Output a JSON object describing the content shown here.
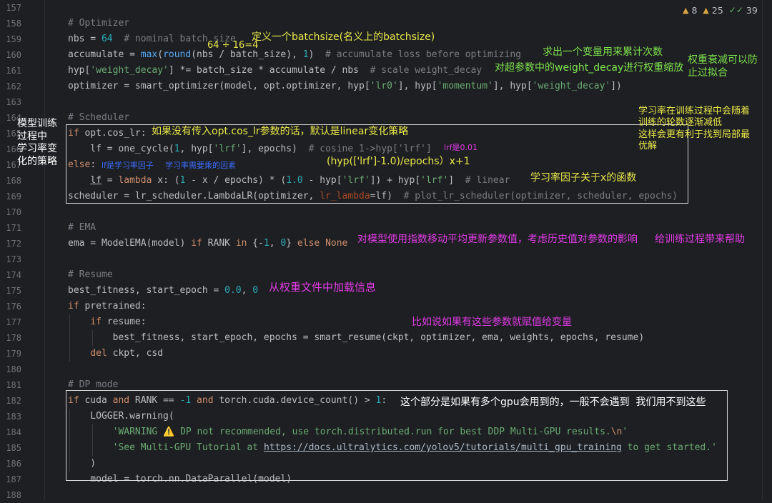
{
  "gutter": {
    "line_numbers": [
      "157",
      "158",
      "159",
      "160",
      "161",
      "162",
      "163",
      "164",
      "165",
      "166",
      "167",
      "168",
      "169",
      "170",
      "171",
      "172",
      "173",
      "174",
      "175",
      "176",
      "177",
      "178",
      "179",
      "180",
      "181",
      "182",
      "183",
      "184",
      "185",
      "186",
      "187",
      "188"
    ]
  },
  "inspection": {
    "warnings_a": "8",
    "warnings_b": "25",
    "ok": "39",
    "icon_warning": "warning-triangle",
    "icon_check": "double-check"
  },
  "code": {
    "l158_cm": "# Optimizer",
    "l159_a": "nbs = ",
    "l159_n": "64",
    "l159_cm": "  # nominal batch size",
    "l160_a": "accumulate = ",
    "l160_f1": "max",
    "l160_b": "(",
    "l160_f2": "round",
    "l160_c": "(nbs / batch_size), ",
    "l160_n": "1",
    "l160_d": ")",
    "l160_cm": "  # accumulate loss before optimizing",
    "l161_a": "hyp[",
    "l161_s": "'weight_decay'",
    "l161_b": "] *= batch_size * accumulate / nbs",
    "l161_cm": "  # scale weight_decay",
    "l162_a": "optimizer = smart_optimizer(model, opt.optimizer, hyp[",
    "l162_s1": "'lr0'",
    "l162_b": "], hyp[",
    "l162_s2": "'momentum'",
    "l162_c": "], hyp[",
    "l162_s3": "'weight_decay'",
    "l162_d": "])",
    "l164_cm": "# Scheduler",
    "l165_k": "if",
    "l165_a": " opt.cos_lr:",
    "l166_a": "    lf = one_cycle(",
    "l166_n": "1",
    "l166_b": ", hyp[",
    "l166_s": "'lrf'",
    "l166_c": "], epochs)",
    "l166_cm": "  # cosine 1->hyp['lrf']",
    "l167_k": "else",
    "l167_a": ":",
    "l168_i": "    ",
    "l168_a": "lf",
    "l168_b": " = ",
    "l168_k": "lambda",
    "l168_c": " x: (",
    "l168_n1": "1",
    "l168_d": " - x / epochs) * (",
    "l168_n2": "1.0",
    "l168_e": " - hyp[",
    "l168_s1": "'lrf'",
    "l168_f": "]) + hyp[",
    "l168_s2": "'lrf'",
    "l168_g": "]",
    "l168_cm": "  # linear",
    "l169_a": "scheduler = lr_scheduler.LambdaLR(optimizer, ",
    "l169_p": "lr_lambda",
    "l169_b": "=lf)",
    "l169_cm": "  # plot_lr_scheduler(optimizer, scheduler, epochs)",
    "l171_cm": "# EMA",
    "l172_a": "ema = ModelEMA(model) ",
    "l172_k1": "if",
    "l172_b": " RANK ",
    "l172_k2": "in",
    "l172_c": " {-",
    "l172_n1": "1",
    "l172_d": ", ",
    "l172_n2": "0",
    "l172_e": "} ",
    "l172_k3": "else",
    "l172_f": " ",
    "l172_k4": "None",
    "l174_cm": "# Resume",
    "l175_a": "best_fitness, start_epoch = ",
    "l175_n1": "0.0",
    "l175_b": ", ",
    "l175_n2": "0",
    "l176_k": "if",
    "l176_a": " pretrained:",
    "l177_i": "    ",
    "l177_k": "if",
    "l177_a": " resume:",
    "l178_a": "        best_fitness, start_epoch, epochs = smart_resume(ckpt, optimizer, ema, weights, epochs, resume)",
    "l179_i": "    ",
    "l179_k": "del",
    "l179_a": " ckpt, csd",
    "l181_cm": "# DP mode",
    "l182_k1": "if",
    "l182_a": " cuda ",
    "l182_k2": "and",
    "l182_b": " RANK == ",
    "l182_n1": "-1",
    "l182_c": " ",
    "l182_k3": "and",
    "l182_d": " torch.cuda.device_count() > ",
    "l182_n2": "1",
    "l182_e": ":",
    "l183_a": "    LOGGER.warning(",
    "l184_i": "        ",
    "l184_s": "'WARNING ⚠️ DP not recommended, use torch.distributed.run for best DDP Multi-GPU results.",
    "l184_esc": "\\n",
    "l184_q": "'",
    "l185_i": "        ",
    "l185_s1": "'See Multi-GPU Tutorial at ",
    "l185_url": "https://docs.ultralytics.com/yolov5/tutorials/multi_gpu_training",
    "l185_s2": " to get started.'",
    "l186_a": "    )",
    "l187_a": "    model = torch.nn.DataParallel(model)"
  },
  "annotations": {
    "batchsize_def": "定义一个batchsize(名义上的batchsize)",
    "division_hint": "64 ÷ 16=4",
    "accumulate_note": "求出一个变量用来累计次数",
    "weight_decay_note": "对超参数中的weight_decay进行权重缩放",
    "weight_decay_purpose": "权重衰减可以防\n止过拟合",
    "left_strategy": "模型训练\n过程中\n学习率变\n化的策略",
    "right_lr_note": "学习率在训练过程中会随着\n训练的轮数逐渐减低\n这样会更有利于找到局部最\n优解",
    "cos_lr_note": "如果没有传入opt.cos_lr参数的话，默认是linear变化策略",
    "lrf_value": "lrf是0.01",
    "formula": "(hyp(['lrf']-1.0)/epochs）x+1",
    "lf_factor": "lf是学习率因子",
    "lr_multiplier": "学习率需要乘的因素",
    "lr_factor_func": "学习率因子关于x的函数",
    "ema_note": "对模型使用指数移动平均更新参数值，考虑历史值对参数的影响",
    "ema_help": "给训练过程带来帮助",
    "resume_load": "从权重文件中加载信息",
    "resume_assign": "比如说如果有这些参数就赋值给变量",
    "dp_note": "这个部分是如果有多个gpu会用到的，一般不会遇到  我们用不到这些"
  },
  "colors": {
    "background": "#1e1f22",
    "annotation_yellow": "#e8e84a",
    "annotation_green": "#7ee34e",
    "annotation_magenta": "#e23be8",
    "annotation_blue": "#3b6cff",
    "keyword": "#cf8e6d",
    "string": "#6aab73",
    "number": "#2aacb8",
    "comment": "#7a7e85"
  }
}
